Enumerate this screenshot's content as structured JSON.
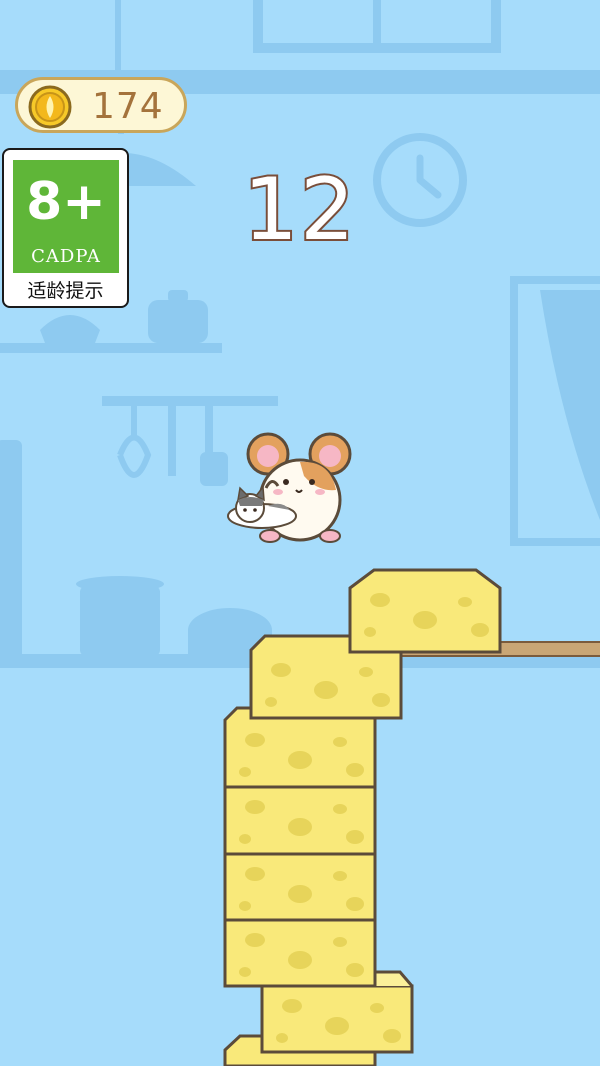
{
  "hud": {
    "coins": "174",
    "score": "12",
    "age_rating": {
      "number": "8+",
      "organization": "CADPA",
      "label": "适龄提示"
    }
  },
  "game": {
    "cheese_tower_blocks": 7,
    "moving_block": true,
    "character": "hamster-carrying-kitten"
  },
  "colors": {
    "sky": "#a6dcfb",
    "silhouette": "#8ecaf0",
    "cheese": "#f9e97a",
    "cheese_hole": "#e7d45a",
    "outline": "#5b4b3a",
    "coin_text": "#a4733c",
    "age_green": "#5fb638"
  }
}
